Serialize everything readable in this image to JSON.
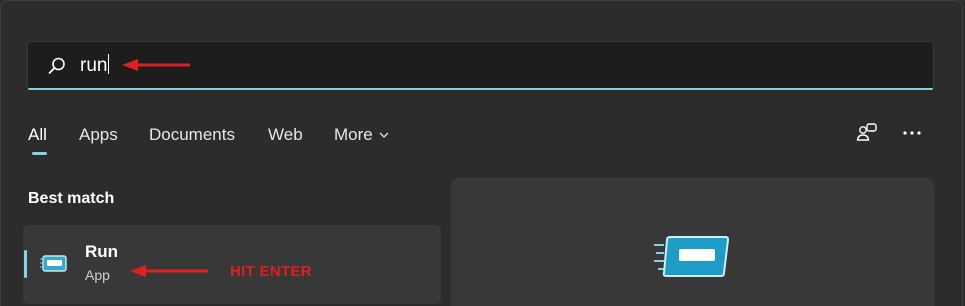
{
  "search": {
    "value": "run"
  },
  "tabs": [
    {
      "label": "All",
      "active": true
    },
    {
      "label": "Apps",
      "active": false
    },
    {
      "label": "Documents",
      "active": false
    },
    {
      "label": "Web",
      "active": false
    },
    {
      "label": "More",
      "active": false
    }
  ],
  "toolbar": {
    "account_icon": "person-switch-icon",
    "more_icon": "ellipsis-icon"
  },
  "best_match": {
    "section_title": "Best match",
    "result": {
      "name": "Run",
      "type": "App",
      "icon": "run-app-icon"
    }
  },
  "annotations": {
    "enter_hint": "HIT ENTER",
    "arrow_color": "#e02020"
  },
  "colors": {
    "accent": "#7fd4e6",
    "background": "#2c2c2c",
    "card": "#383838",
    "search_bg": "#1d1d1d"
  }
}
